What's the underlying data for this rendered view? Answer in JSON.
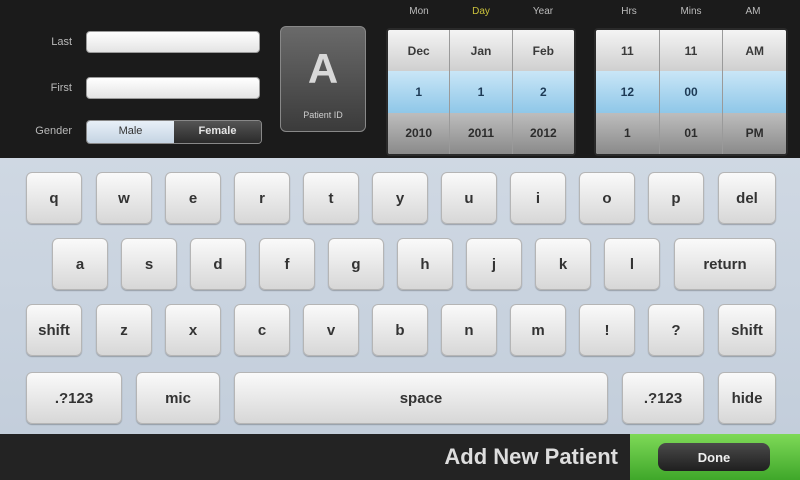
{
  "form": {
    "fields": [
      {
        "label": "Last",
        "value": ""
      },
      {
        "label": "First",
        "value": ""
      }
    ],
    "sex": {
      "label": "Gender",
      "options": [
        "Male",
        "Female"
      ],
      "selected": "Female"
    },
    "id_card": {
      "glyph": "A",
      "caption": "Patient ID"
    }
  },
  "dob": {
    "headers": [
      "Mon",
      "Day",
      "Year"
    ],
    "accent_header": 1,
    "columns": [
      [
        "Dec",
        "Jan",
        "Feb"
      ],
      [
        "1",
        "1",
        "2"
      ],
      [
        "2010",
        "2011",
        "2012"
      ]
    ]
  },
  "time": {
    "headers": [
      "Hrs",
      "Mins",
      "AM"
    ],
    "columns": [
      [
        "11",
        "11",
        "AM"
      ],
      [
        "12",
        "00",
        ""
      ],
      [
        "1",
        "01",
        "PM"
      ]
    ]
  },
  "keyboard": {
    "rows": [
      [
        "q",
        "w",
        "e",
        "r",
        "t",
        "y",
        "u",
        "i",
        "o",
        "p",
        "del"
      ],
      [
        "a",
        "s",
        "d",
        "f",
        "g",
        "h",
        "j",
        "k",
        "l",
        "return"
      ],
      [
        "shift",
        "z",
        "x",
        "c",
        "v",
        "b",
        "n",
        "m",
        "!",
        "?",
        "shift"
      ],
      [
        ".?123",
        "mic",
        "space",
        ".?123",
        "hide"
      ]
    ]
  },
  "footer": {
    "title": "Add New Patient",
    "done_label": "Done"
  },
  "colors": {
    "done_green": "#5cc23d",
    "selection_blue": "#9fd2ef",
    "accent_yellow": "#c9c03b"
  }
}
